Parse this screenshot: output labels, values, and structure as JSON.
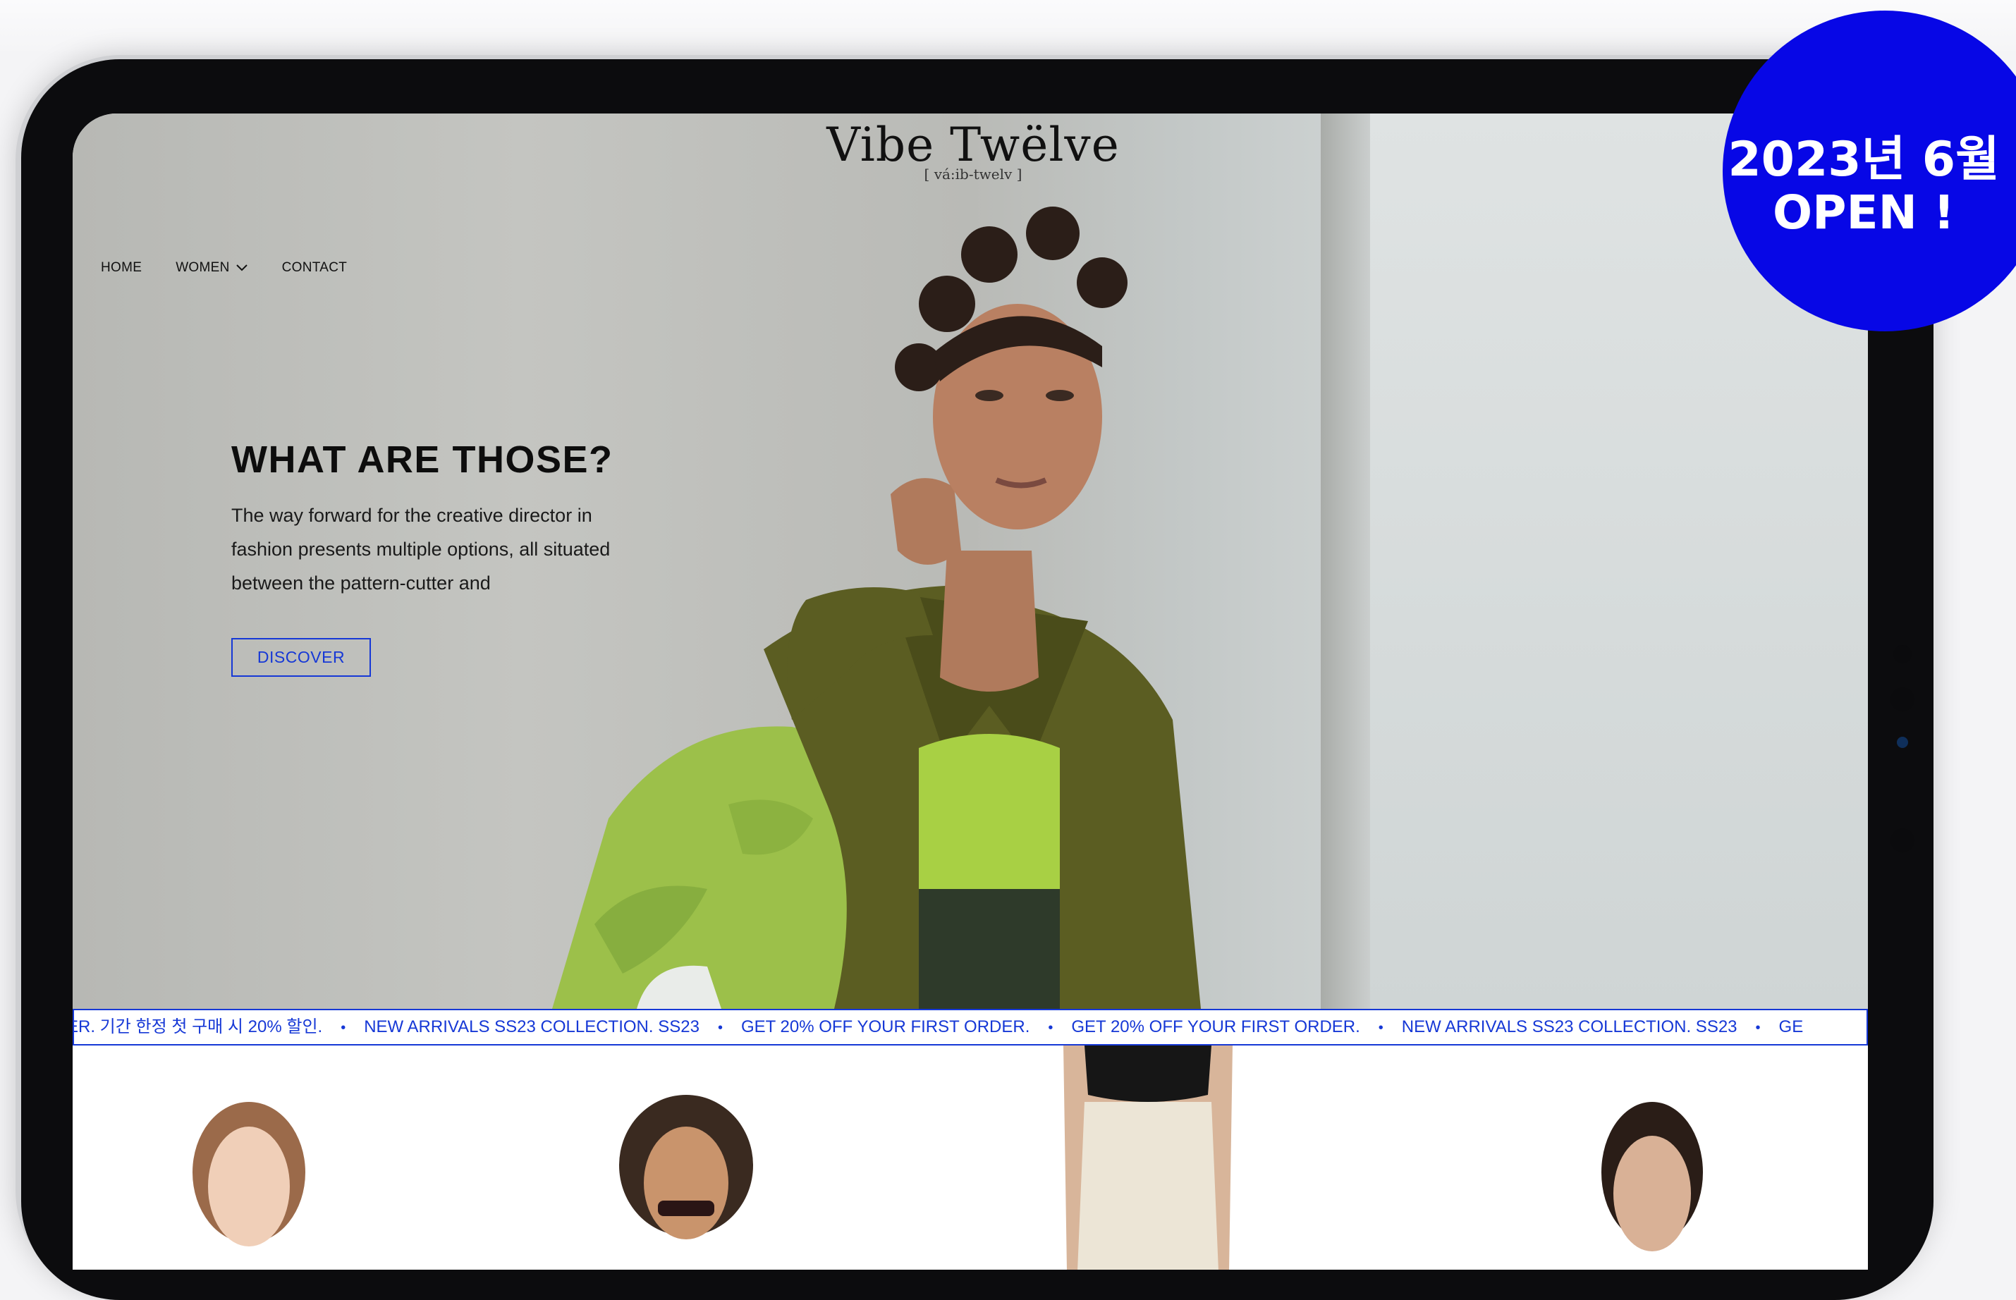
{
  "nav": {
    "home": "HOME",
    "women": "WOMEN",
    "contact": "CONTACT"
  },
  "logo": {
    "title": "Vibe Twëlve",
    "subtitle": "[ vá:ib-twelv ]"
  },
  "hero": {
    "heading": "WHAT ARE THOSE?",
    "body": "The way forward for the creative director in fashion presents multiple options, all situated between the pattern-cutter and",
    "cta": "DISCOVER"
  },
  "ticker": {
    "items": [
      "ER. 기간 한정 첫 구매 시 20% 할인.",
      "NEW ARRIVALS SS23 COLLECTION. SS23",
      "GET 20% OFF YOUR FIRST ORDER.",
      "GET 20% OFF YOUR FIRST ORDER.",
      "NEW ARRIVALS SS23 COLLECTION. SS23",
      "GE"
    ],
    "separator": "•"
  },
  "badge": {
    "line1": "2023년 6월",
    "line2": "OPEN !"
  },
  "colors": {
    "accent": "#1638d6",
    "badge": "#0707e6"
  },
  "icons": {
    "women_dropdown": "chevron-down-icon"
  }
}
